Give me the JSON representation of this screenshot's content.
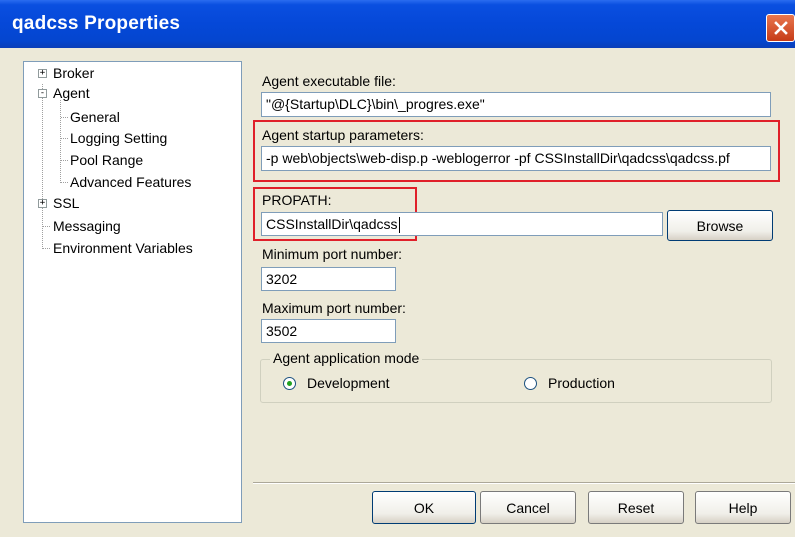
{
  "window": {
    "title": "qadcss Properties",
    "close_icon": "close-icon"
  },
  "tree": {
    "items": [
      {
        "label": "Broker",
        "expander": "+"
      },
      {
        "label": "Agent",
        "expander": "-"
      },
      {
        "label": "General"
      },
      {
        "label": "Logging Setting"
      },
      {
        "label": "Pool Range"
      },
      {
        "label": "Advanced Features"
      },
      {
        "label": "SSL",
        "expander": "+"
      },
      {
        "label": "Messaging"
      },
      {
        "label": "Environment Variables"
      }
    ]
  },
  "form": {
    "exec_label": "Agent executable file:",
    "exec_value": "\"@{Startup\\DLC}\\bin\\_progres.exe\"",
    "startup_label": "Agent startup parameters:",
    "startup_value": "-p web\\objects\\web-disp.p -weblogerror -pf CSSInstallDir\\qadcss\\qadcss.pf",
    "propath_label": "PROPATH:",
    "propath_value": "CSSInstallDir\\qadcss",
    "browse_label": "Browse",
    "min_port_label": "Minimum port number:",
    "min_port_value": "3202",
    "max_port_label": "Maximum port number:",
    "max_port_value": "3502",
    "mode_legend": "Agent application mode",
    "mode_options": [
      {
        "label": "Development",
        "selected": true
      },
      {
        "label": "Production",
        "selected": false
      }
    ]
  },
  "buttons": {
    "ok": "OK",
    "cancel": "Cancel",
    "reset": "Reset",
    "help": "Help"
  },
  "colors": {
    "titlebar": "#0548d8",
    "highlight_box": "#e0202a",
    "radio_selected": "#21a121"
  }
}
